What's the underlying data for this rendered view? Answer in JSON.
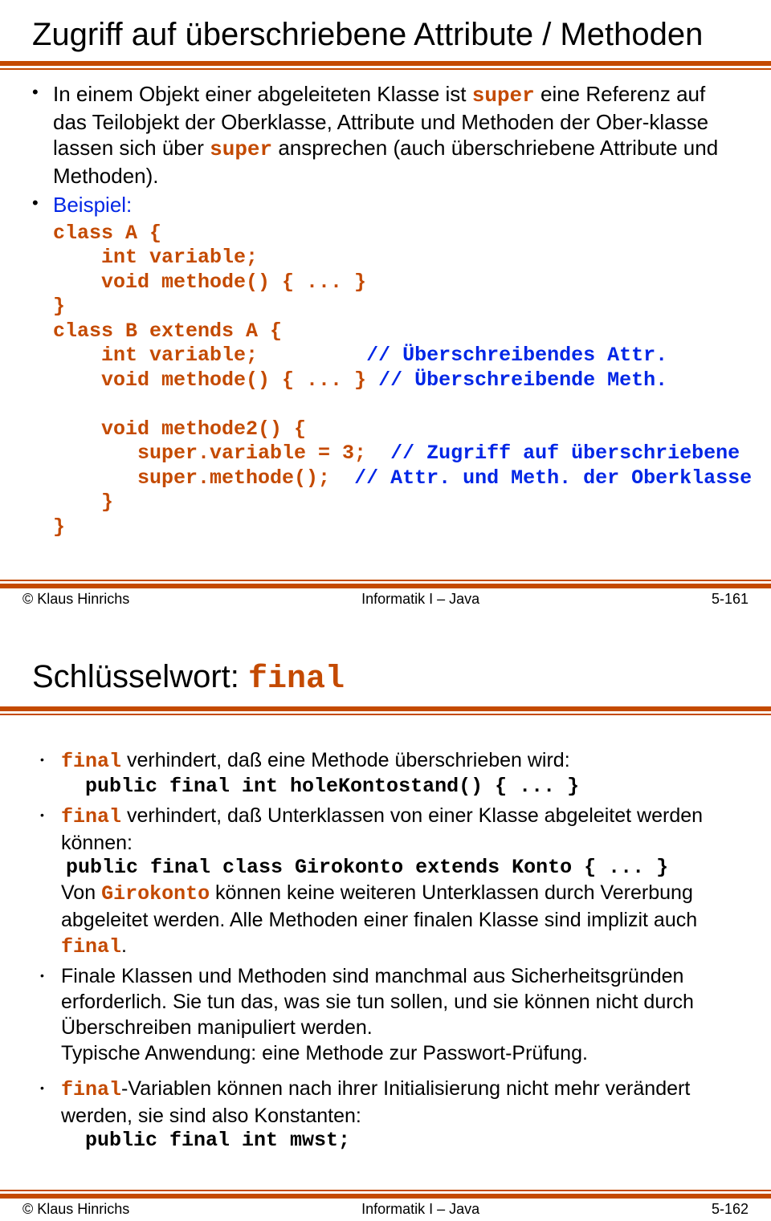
{
  "slide1": {
    "title": "Zugriff auf überschriebene Attribute / Methoden",
    "bullet1_a": "In einem Objekt einer abgeleiteten Klasse ist ",
    "bullet1_kw1": "super",
    "bullet1_b": " eine Referenz auf das Teilobjekt der Oberklasse, Attribute und Methoden der Ober-klasse lassen sich über ",
    "bullet1_kw2": "super",
    "bullet1_c": " ansprechen (auch überschriebene Attribute und Methoden).",
    "bullet2": "Beispiel:",
    "code_l1": "class A {",
    "code_l2": "    int variable;",
    "code_l3": "    void methode() { ... }",
    "code_l4": "}",
    "code_l5": "class B extends A {",
    "code_l6a": "    int variable;",
    "code_l6b": "         // Überschreibendes Attr.",
    "code_l7a": "    void methode() { ... }",
    "code_l7b": " // Überschreibende Meth.",
    "code_l8": "    void methode2() {",
    "code_l9a": "       super.variable = 3;",
    "code_l9b": "  // Zugriff auf überschriebene",
    "code_l10a": "       super.methode();",
    "code_l10b": "  // Attr. und Meth. der Oberklasse",
    "code_l11": "    }",
    "code_l12": "}",
    "footer_left": "© Klaus Hinrichs",
    "footer_mid": "Informatik I – Java",
    "footer_right": "5-161"
  },
  "slide2": {
    "title_a": "Schlüsselwort: ",
    "title_kw": "final",
    "b1_kw": "final",
    "b1_txt": " verhindert, daß eine Methode überschrieben wird:",
    "b1_code": "public final int holeKontostand() { ... }",
    "b2_kw": "final",
    "b2_txt": " verhindert, daß Unterklassen von einer Klasse abgeleitet werden können:",
    "b2_code": "public final class Girokonto extends Konto { ... }",
    "b2_after_a": "Von ",
    "b2_after_kw": "Girokonto",
    "b2_after_b": " können keine weiteren Unterklassen durch Vererbung abgeleitet werden. Alle Methoden einer finalen Klasse sind implizit auch ",
    "b2_after_kw2": "final",
    "b2_after_c": ".",
    "b3_txt": "Finale Klassen und Methoden sind manchmal aus Sicherheitsgründen erforderlich. Sie tun das, was sie tun sollen, und sie können nicht durch Überschreiben manipuliert werden.",
    "b3_txt2": "Typische Anwendung: eine Methode zur Passwort-Prüfung.",
    "b4_kw": "final",
    "b4_txt": "-Variablen können nach ihrer Initialisierung nicht mehr verändert werden, sie sind also Konstanten:",
    "b4_code": "public final int mwst;",
    "footer_left": "© Klaus Hinrichs",
    "footer_mid": "Informatik I – Java",
    "footer_right": "5-162"
  }
}
